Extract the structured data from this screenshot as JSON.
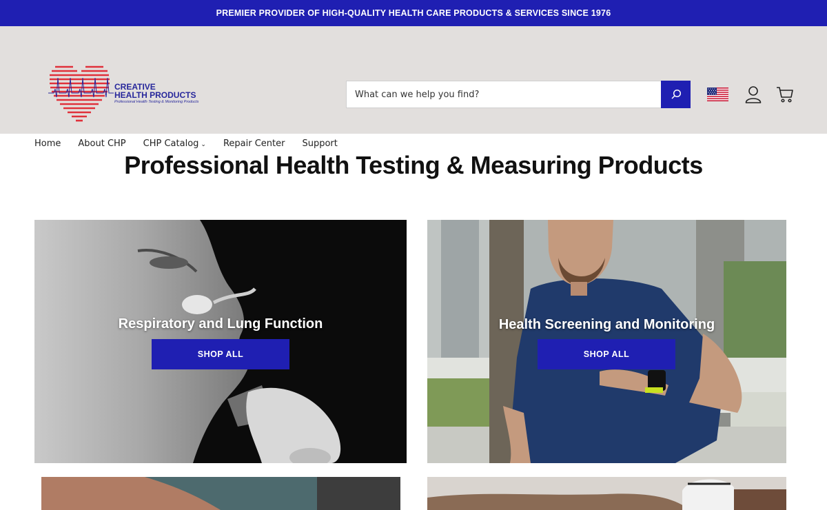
{
  "announcement": "PREMIER PROVIDER OF HIGH-QUALITY HEALTH CARE PRODUCTS & SERVICES SINCE 1976",
  "logo": {
    "line1": "CREATIVE",
    "line2": "HEALTH PRODUCTS",
    "tagline": "Professional Health Testing & Monitoring Products"
  },
  "search": {
    "placeholder": "What can we help you find?"
  },
  "icons": {
    "search": "search-icon",
    "flag": "us-flag-icon",
    "account": "user-icon",
    "cart": "cart-icon"
  },
  "nav": {
    "items": [
      {
        "label": "Home"
      },
      {
        "label": "About CHP"
      },
      {
        "label": "CHP Catalog",
        "has_dropdown": true
      },
      {
        "label": "Repair Center"
      },
      {
        "label": "Support"
      }
    ]
  },
  "main": {
    "title": "Professional Health Testing & Measuring Products",
    "cards": [
      {
        "title": "Respiratory and Lung Function",
        "button": "SHOP ALL"
      },
      {
        "title": "Health Screening and Monitoring",
        "button": "SHOP ALL"
      }
    ]
  },
  "colors": {
    "brand_blue": "#1f1fb2",
    "header_bg": "#e2dfdd",
    "logo_red": "#e0303a"
  }
}
